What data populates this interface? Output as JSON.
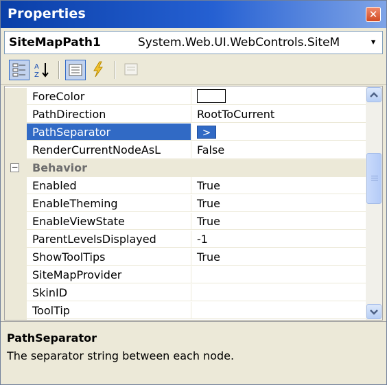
{
  "window": {
    "title": "Properties",
    "close_glyph": "✕"
  },
  "object_selector": {
    "name": "SiteMapPath1",
    "type": "System.Web.UI.WebControls.SiteM",
    "dropdown_glyph": "▾"
  },
  "toolbar": {
    "buttons": [
      {
        "name": "categorized-icon",
        "active": true
      },
      {
        "name": "alphabetical-icon",
        "active": false
      },
      {
        "name": "properties-icon",
        "active": true
      },
      {
        "name": "events-icon",
        "active": false
      },
      {
        "name": "property-pages-icon",
        "active": false
      }
    ]
  },
  "grid": {
    "rows": [
      {
        "kind": "prop",
        "label": "ForeColor",
        "value": "",
        "value_kind": "color"
      },
      {
        "kind": "prop",
        "label": "PathDirection",
        "value": "RootToCurrent"
      },
      {
        "kind": "prop",
        "label": "PathSeparator",
        "value": ">",
        "value_kind": "selected-box",
        "selected": true
      },
      {
        "kind": "prop",
        "label": "RenderCurrentNodeAsL",
        "value": "False"
      },
      {
        "kind": "category",
        "label": "Behavior",
        "expander": "−"
      },
      {
        "kind": "prop",
        "label": "Enabled",
        "value": "True"
      },
      {
        "kind": "prop",
        "label": "EnableTheming",
        "value": "True"
      },
      {
        "kind": "prop",
        "label": "EnableViewState",
        "value": "True"
      },
      {
        "kind": "prop",
        "label": "ParentLevelsDisplayed",
        "value": "-1"
      },
      {
        "kind": "prop",
        "label": "ShowToolTips",
        "value": "True"
      },
      {
        "kind": "prop",
        "label": "SiteMapProvider",
        "value": ""
      },
      {
        "kind": "prop",
        "label": "SkinID",
        "value": ""
      },
      {
        "kind": "prop",
        "label": "ToolTip",
        "value": ""
      }
    ]
  },
  "description": {
    "heading": "PathSeparator",
    "text": "The separator string between each node."
  },
  "colors": {
    "selection": "#316ac5",
    "title_bar": "#0a3fa8",
    "panel": "#ece9d8"
  }
}
